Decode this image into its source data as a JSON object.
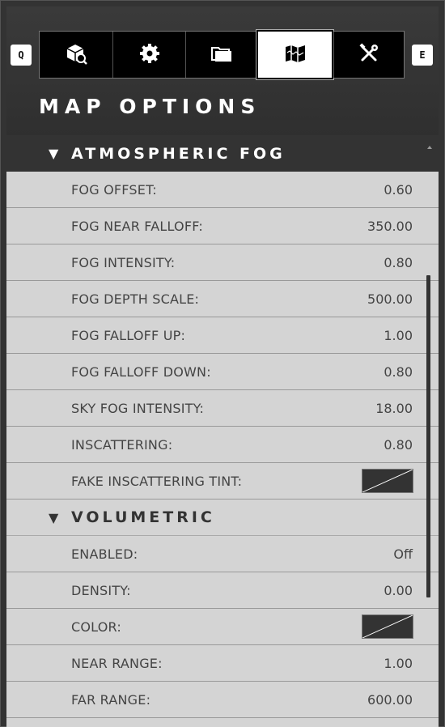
{
  "keys": {
    "prev": "Q",
    "next": "E"
  },
  "tabs": [
    {
      "icon": "cube-search-icon",
      "active": false
    },
    {
      "icon": "gear-icon",
      "active": false
    },
    {
      "icon": "folder-icon",
      "active": false
    },
    {
      "icon": "map-icon",
      "active": true
    },
    {
      "icon": "tools-icon",
      "active": false
    }
  ],
  "title": "MAP OPTIONS",
  "sections": {
    "atmospheric_fog": {
      "caret": "▼",
      "title": "ATMOSPHERIC FOG",
      "rows": [
        {
          "label": "FOG OFFSET:",
          "value": "0.60"
        },
        {
          "label": "FOG NEAR FALLOFF:",
          "value": "350.00"
        },
        {
          "label": "FOG INTENSITY:",
          "value": "0.80"
        },
        {
          "label": "FOG DEPTH SCALE:",
          "value": "500.00"
        },
        {
          "label": "FOG FALLOFF UP:",
          "value": "1.00"
        },
        {
          "label": "FOG FALLOFF DOWN:",
          "value": "0.80"
        },
        {
          "label": "SKY FOG INTENSITY:",
          "value": "18.00"
        },
        {
          "label": "INSCATTERING:",
          "value": "0.80"
        },
        {
          "label": "FAKE INSCATTERING TINT:",
          "value": ""
        }
      ]
    },
    "volumetric": {
      "caret": "▼",
      "title": "VOLUMETRIC",
      "rows": [
        {
          "label": "ENABLED:",
          "value": "Off"
        },
        {
          "label": "DENSITY:",
          "value": "0.00"
        },
        {
          "label": "COLOR:",
          "value": ""
        },
        {
          "label": "NEAR RANGE:",
          "value": "1.00"
        },
        {
          "label": "FAR RANGE:",
          "value": "600.00"
        }
      ]
    }
  },
  "colors": {
    "swatch_fill": "#333333",
    "swatch_slash": "#ffffff",
    "header_bg": "#333333",
    "row_bg": "#d4d4d4"
  }
}
